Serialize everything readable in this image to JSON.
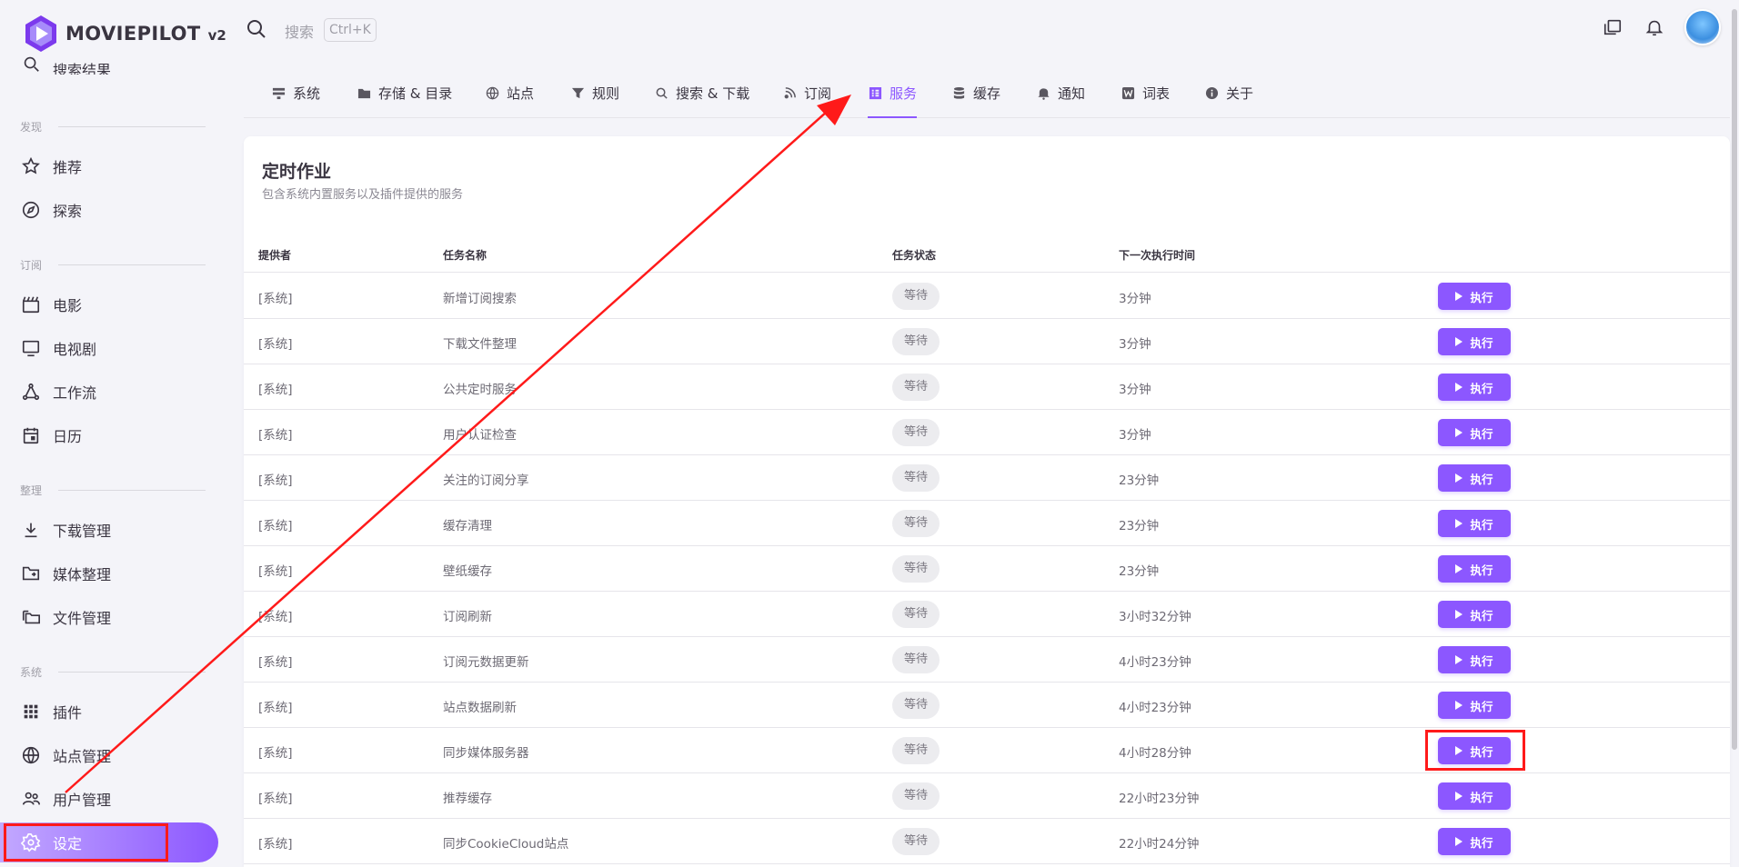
{
  "brand": {
    "name": "MOVIEPILOT",
    "version": "v2"
  },
  "sidebar": {
    "partial_item": "搜索结果",
    "sections": [
      {
        "label": "发现",
        "items": [
          "推荐",
          "探索"
        ]
      },
      {
        "label": "订阅",
        "items": [
          "电影",
          "电视剧",
          "工作流",
          "日历"
        ]
      },
      {
        "label": "整理",
        "items": [
          "下载管理",
          "媒体整理",
          "文件管理"
        ]
      },
      {
        "label": "系统",
        "items": [
          "插件",
          "站点管理",
          "用户管理",
          "设定"
        ]
      }
    ]
  },
  "topbar": {
    "search_placeholder": "搜索",
    "shortcut": "Ctrl+K"
  },
  "tabs": [
    "系统",
    "存储 & 目录",
    "站点",
    "规则",
    "搜索 & 下载",
    "订阅",
    "服务",
    "缓存",
    "通知",
    "词表",
    "关于"
  ],
  "active_tab": "服务",
  "card": {
    "title": "定时作业",
    "subtitle": "包含系统内置服务以及插件提供的服务",
    "columns": [
      "提供者",
      "任务名称",
      "任务状态",
      "下一次执行时间"
    ],
    "rows": [
      {
        "provider": "[系统]",
        "name": "新增订阅搜索",
        "status": "等待",
        "next": "3分钟",
        "action": "执行"
      },
      {
        "provider": "[系统]",
        "name": "下载文件整理",
        "status": "等待",
        "next": "3分钟",
        "action": "执行"
      },
      {
        "provider": "[系统]",
        "name": "公共定时服务",
        "status": "等待",
        "next": "3分钟",
        "action": "执行"
      },
      {
        "provider": "[系统]",
        "name": "用户认证检查",
        "status": "等待",
        "next": "3分钟",
        "action": "执行"
      },
      {
        "provider": "[系统]",
        "name": "关注的订阅分享",
        "status": "等待",
        "next": "23分钟",
        "action": "执行"
      },
      {
        "provider": "[系统]",
        "name": "缓存清理",
        "status": "等待",
        "next": "23分钟",
        "action": "执行"
      },
      {
        "provider": "[系统]",
        "name": "壁纸缓存",
        "status": "等待",
        "next": "23分钟",
        "action": "执行"
      },
      {
        "provider": "[系统]",
        "name": "订阅刷新",
        "status": "等待",
        "next": "3小时32分钟",
        "action": "执行"
      },
      {
        "provider": "[系统]",
        "name": "订阅元数据更新",
        "status": "等待",
        "next": "4小时23分钟",
        "action": "执行"
      },
      {
        "provider": "[系统]",
        "name": "站点数据刷新",
        "status": "等待",
        "next": "4小时23分钟",
        "action": "执行"
      },
      {
        "provider": "[系统]",
        "name": "同步媒体服务器",
        "status": "等待",
        "next": "4小时28分钟",
        "action": "执行"
      },
      {
        "provider": "[系统]",
        "name": "推荐缓存",
        "status": "等待",
        "next": "22小时23分钟",
        "action": "执行"
      },
      {
        "provider": "[系统]",
        "name": "同步CookieCloud站点",
        "status": "等待",
        "next": "22小时24分钟",
        "action": "执行"
      }
    ]
  },
  "colors": {
    "accent": "#8c57ff",
    "annotation": "#ff1a1a"
  }
}
